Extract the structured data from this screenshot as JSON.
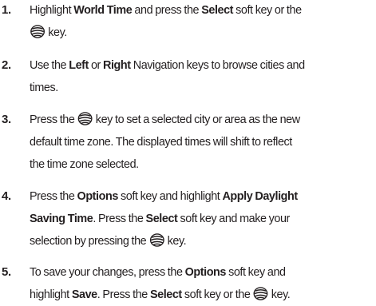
{
  "steps": [
    {
      "number": "1.",
      "lines": [
        [
          {
            "t": "Highlight "
          },
          {
            "t": "World Time",
            "b": true
          },
          {
            "t": " and press the "
          },
          {
            "t": "Select",
            "b": true
          },
          {
            "t": " soft key or the"
          }
        ],
        [
          {
            "icon": "select-key-icon"
          },
          {
            "t": " key."
          }
        ]
      ]
    },
    {
      "number": "2.",
      "lines": [
        [
          {
            "t": "Use the "
          },
          {
            "t": "Left",
            "b": true
          },
          {
            "t": " or "
          },
          {
            "t": "Right",
            "b": true
          },
          {
            "t": " Navigation keys to browse cities and"
          }
        ],
        [
          {
            "t": "times."
          }
        ]
      ]
    },
    {
      "number": "3.",
      "lines": [
        [
          {
            "t": "Press the "
          },
          {
            "icon": "select-key-icon"
          },
          {
            "t": " key to set a selected city or area as the new"
          }
        ],
        [
          {
            "t": "default time zone. The displayed times will shift to reflect"
          }
        ],
        [
          {
            "t": "the time zone selected."
          }
        ]
      ]
    },
    {
      "number": "4.",
      "lines": [
        [
          {
            "t": "Press the "
          },
          {
            "t": "Options",
            "b": true
          },
          {
            "t": " soft key and highlight "
          },
          {
            "t": "Apply Daylight",
            "b": true
          }
        ],
        [
          {
            "t": "Saving Time",
            "b": true
          },
          {
            "t": ". Press the "
          },
          {
            "t": "Select",
            "b": true
          },
          {
            "t": " soft key and make your"
          }
        ],
        [
          {
            "t": "selection by pressing the "
          },
          {
            "icon": "select-key-icon"
          },
          {
            "t": " key."
          }
        ]
      ]
    },
    {
      "number": "5.",
      "lines": [
        [
          {
            "t": "To save your changes, press the "
          },
          {
            "t": "Options",
            "b": true
          },
          {
            "t": " soft key and"
          }
        ],
        [
          {
            "t": "highlight "
          },
          {
            "t": "Save",
            "b": true
          },
          {
            "t": ". Press the "
          },
          {
            "t": "Select",
            "b": true
          },
          {
            "t": " soft key or the "
          },
          {
            "icon": "select-key-icon"
          },
          {
            "t": " key."
          }
        ]
      ]
    }
  ]
}
